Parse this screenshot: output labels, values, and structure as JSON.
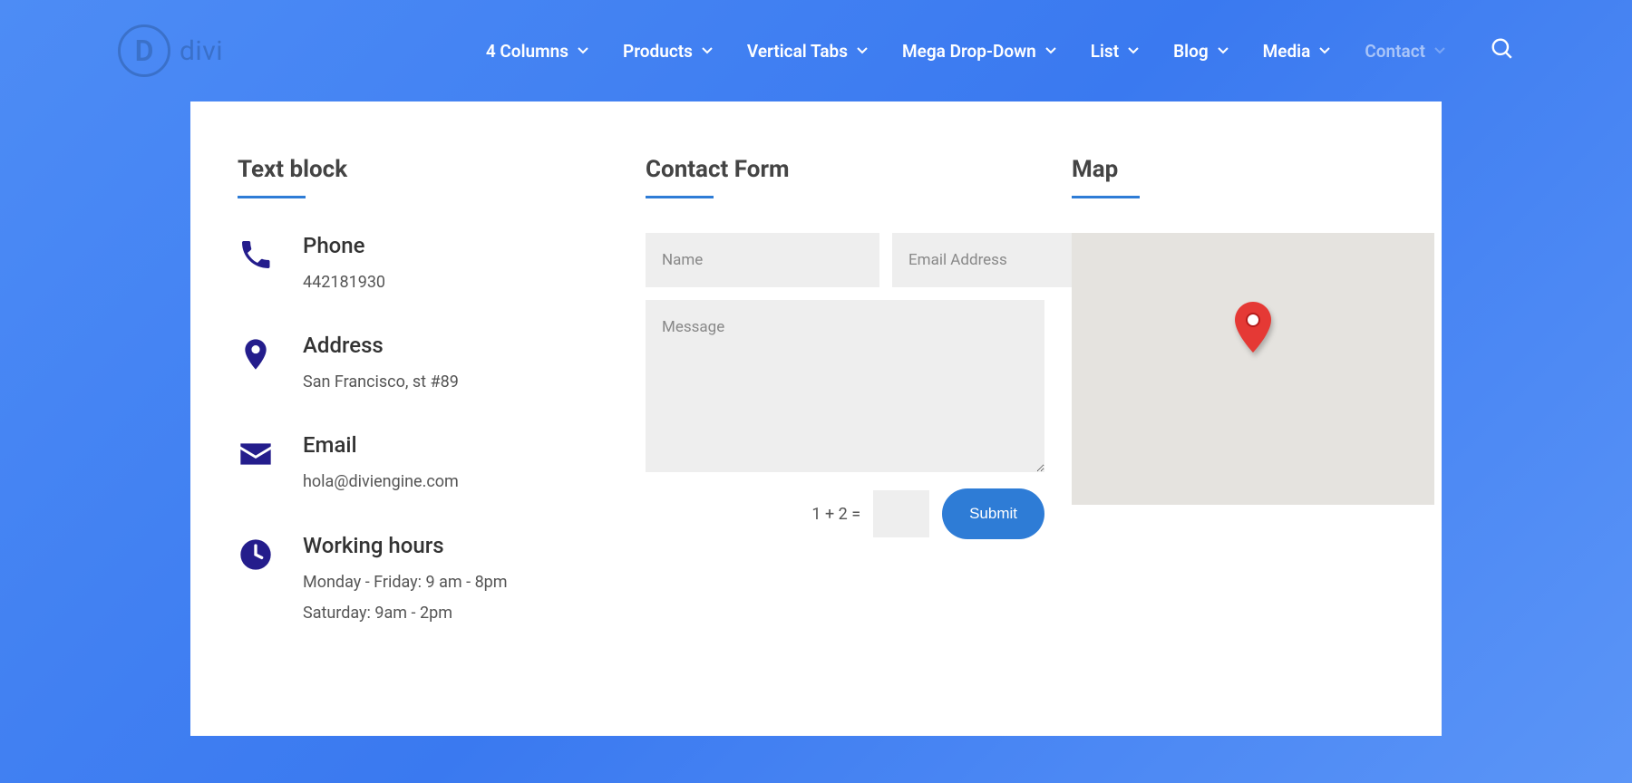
{
  "brand": {
    "letter": "D",
    "name": "divi"
  },
  "nav": [
    {
      "label": "4 Columns",
      "dim": false
    },
    {
      "label": "Products",
      "dim": false
    },
    {
      "label": "Vertical Tabs",
      "dim": false
    },
    {
      "label": "Mega Drop-Down",
      "dim": false
    },
    {
      "label": "List",
      "dim": false
    },
    {
      "label": "Blog",
      "dim": false
    },
    {
      "label": "Media",
      "dim": false
    },
    {
      "label": "Contact",
      "dim": true
    }
  ],
  "sections": {
    "textblock": "Text block",
    "contactform": "Contact Form",
    "map": "Map"
  },
  "info": {
    "phone": {
      "title": "Phone",
      "value": "442181930"
    },
    "address": {
      "title": "Address",
      "value": "San Francisco, st #89"
    },
    "email": {
      "title": "Email",
      "value": "hola@diviengine.com"
    },
    "hours": {
      "title": "Working hours",
      "line1": "Monday - Friday: 9 am - 8pm",
      "line2": "Saturday: 9am - 2pm"
    }
  },
  "form": {
    "name_placeholder": "Name",
    "email_placeholder": "Email Address",
    "message_placeholder": "Message",
    "captcha_question": "1 + 2 =",
    "submit_label": "Submit"
  }
}
